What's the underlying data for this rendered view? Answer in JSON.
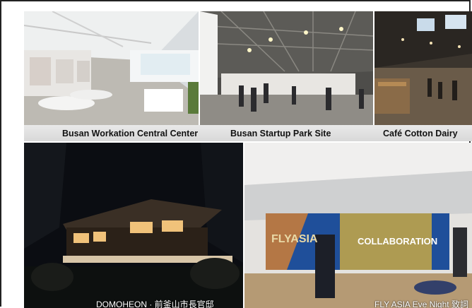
{
  "photos": {
    "workation": {
      "caption": "Busan Workation Central Center"
    },
    "startup_park": {
      "caption": "Busan Startup Park Site"
    },
    "cafe": {
      "caption": "Café Cotton Dairy"
    },
    "domoheon": {
      "caption": "DOMOHEON · 前釜山市長官邸"
    },
    "fly_asia": {
      "caption": "FLY ASIA Eve Night 致詞",
      "screen_logo": "FLYASIA",
      "screen_headline": "COLLABORATION"
    }
  },
  "colors": {
    "caption_bar": "#dcdcdc",
    "night_sky": "#0b0d12",
    "screen_blue": "#1f4f9a",
    "screen_gold": "#c8a845"
  }
}
